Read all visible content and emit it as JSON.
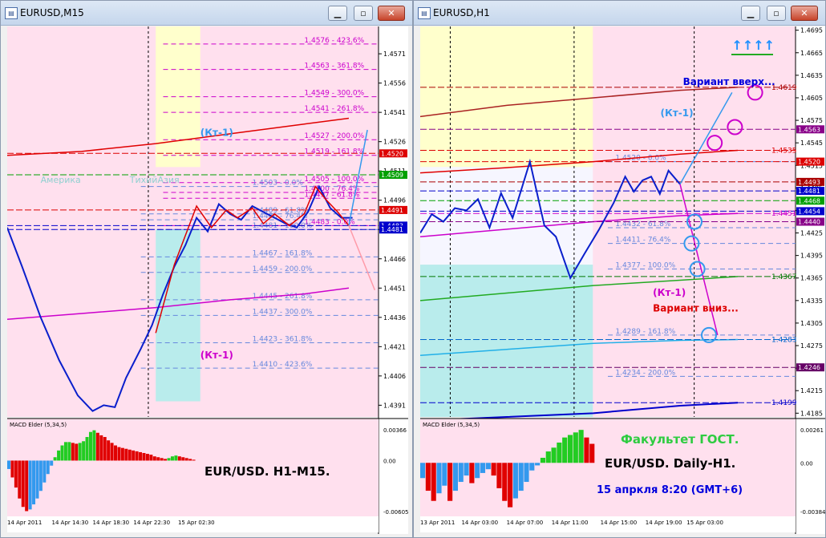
{
  "windows": [
    {
      "title": "EURUSD,M15",
      "chart_data": {
        "type": "line",
        "symbol": "EURUSD",
        "timeframe": "M15",
        "ylim": [
          1.4385,
          1.4585
        ],
        "price_ticks": [
          "1.4571",
          "1.4556",
          "1.4541",
          "1.4526",
          "1.4511",
          "1.4496",
          "1.4481",
          "1.4466",
          "1.4451",
          "1.4436",
          "1.4421",
          "1.4406",
          "1.4391"
        ],
        "price_tick_values": [
          1.4571,
          1.4556,
          1.4541,
          1.4526,
          1.4511,
          1.4496,
          1.4481,
          1.4466,
          1.4451,
          1.4436,
          1.4421,
          1.4406,
          1.4391
        ],
        "time_labels": [
          "14 Apr 2011",
          "14 Apr 14:30",
          "14 Apr 18:30",
          "14 Apr 22:30",
          "15 Apr 02:30"
        ],
        "fib_labels": [
          {
            "price": 1.4576,
            "text": "1.4576 - 423.6%",
            "color": "#cc00cc"
          },
          {
            "price": 1.4563,
            "text": "1.4563 - 361.8%",
            "color": "#cc00cc"
          },
          {
            "price": 1.4549,
            "text": "1.4549 - 300.0%",
            "color": "#cc00cc"
          },
          {
            "price": 1.4541,
            "text": "1.4541 - 261.8%",
            "color": "#cc00cc"
          },
          {
            "price": 1.4527,
            "text": "1.4527 - 200.0%",
            "color": "#cc00cc"
          },
          {
            "price": 1.4519,
            "text": "1.4519 - 161.8%",
            "color": "#cc00cc"
          },
          {
            "price": 1.4505,
            "text": "1.4505 - 100.0%",
            "color": "#cc00cc"
          },
          {
            "price": 1.45,
            "text": "1.4500 - 76.4%",
            "color": "#cc00cc"
          },
          {
            "price": 1.4497,
            "text": "1.4497 - 61.8%",
            "color": "#cc00cc"
          },
          {
            "price": 1.4483,
            "text": "1.4483 - 0.0%",
            "color": "#cc00cc"
          },
          {
            "price": 1.4503,
            "text": "1.4503 - 0.0%",
            "color": "#6688dd"
          },
          {
            "price": 1.4489,
            "text": "1.4489 - 61.8%",
            "color": "#6688dd"
          },
          {
            "price": 1.4486,
            "text": "1.4486 - 76.4%",
            "color": "#6688dd"
          },
          {
            "price": 1.4481,
            "text": "1.4481 - 100.0%",
            "color": "#6688dd"
          },
          {
            "price": 1.4467,
            "text": "1.4467 - 161.8%",
            "color": "#6688dd"
          },
          {
            "price": 1.4459,
            "text": "1.4459 - 200.0%",
            "color": "#6688dd"
          },
          {
            "price": 1.4445,
            "text": "1.4445 - 261.8%",
            "color": "#6688dd"
          },
          {
            "price": 1.4437,
            "text": "1.4437 - 300.0%",
            "color": "#6688dd"
          },
          {
            "price": 1.4423,
            "text": "1.4423 - 361.8%",
            "color": "#6688dd"
          },
          {
            "price": 1.441,
            "text": "1.4410 - 423.6%",
            "color": "#6688dd"
          }
        ],
        "price_tags": [
          {
            "price": 1.452,
            "text": "1.4520",
            "bg": "#dd0000"
          },
          {
            "price": 1.4509,
            "text": "1.4509",
            "bg": "#00a000"
          },
          {
            "price": 1.4491,
            "text": "1.4491",
            "bg": "#dd0000"
          },
          {
            "price": 1.4483,
            "text": "1.4483",
            "bg": "#0000cc"
          },
          {
            "price": 1.4481,
            "text": "1.4481",
            "bg": "#0000cc"
          }
        ],
        "session_labels": [
          "Америка",
          "ТихийАзия"
        ],
        "annotations": {
          "up_label": "(Кт-1)",
          "down_label": "(Кт-1)",
          "caption": "EUR/USD. H1-M15."
        },
        "price_path": [
          [
            0,
            1.4482
          ],
          [
            4,
            1.4462
          ],
          [
            9,
            1.4436
          ],
          [
            14,
            1.4414
          ],
          [
            19,
            1.4396
          ],
          [
            23,
            1.4388
          ],
          [
            26,
            1.4391
          ],
          [
            29,
            1.439
          ],
          [
            32,
            1.4405
          ],
          [
            36,
            1.442
          ],
          [
            39,
            1.4432
          ],
          [
            42,
            1.4448
          ],
          [
            45,
            1.4462
          ],
          [
            48,
            1.4473
          ],
          [
            51,
            1.4487
          ],
          [
            54,
            1.448
          ],
          [
            57,
            1.4494
          ],
          [
            60,
            1.4489
          ],
          [
            63,
            1.4486
          ],
          [
            66,
            1.4493
          ],
          [
            69,
            1.449
          ],
          [
            72,
            1.4487
          ],
          [
            75,
            1.4484
          ],
          [
            78,
            1.4482
          ],
          [
            81,
            1.449
          ],
          [
            84,
            1.4503
          ],
          [
            87,
            1.4492
          ],
          [
            90,
            1.4487
          ],
          [
            93,
            1.4487
          ]
        ],
        "red_path": [
          [
            40,
            1.4428
          ],
          [
            45,
            1.4463
          ],
          [
            48,
            1.4478
          ],
          [
            51,
            1.4493
          ],
          [
            55,
            1.4482
          ],
          [
            59,
            1.4491
          ],
          [
            62,
            1.4487
          ],
          [
            66,
            1.4492
          ],
          [
            69,
            1.4484
          ],
          [
            72,
            1.4489
          ],
          [
            76,
            1.4483
          ],
          [
            80,
            1.4489
          ],
          [
            83,
            1.4503
          ],
          [
            86,
            1.4496
          ],
          [
            89,
            1.449
          ],
          [
            92,
            1.4483
          ]
        ],
        "projection_up": [
          [
            92,
            1.4483
          ],
          [
            97,
            1.4532
          ]
        ],
        "projection_down": [
          [
            92,
            1.4483
          ],
          [
            99,
            1.445
          ]
        ],
        "red_ma": [
          [
            0,
            1.4519
          ],
          [
            20,
            1.4521
          ],
          [
            40,
            1.4525
          ],
          [
            60,
            1.453
          ],
          [
            80,
            1.4535
          ],
          [
            92,
            1.4538
          ]
        ],
        "magenta_ma": [
          [
            0,
            1.4435
          ],
          [
            20,
            1.4438
          ],
          [
            40,
            1.4441
          ],
          [
            60,
            1.4445
          ],
          [
            80,
            1.4448
          ],
          [
            92,
            1.4451
          ]
        ],
        "macd": {
          "label": "MACD Elder (5,34,5)",
          "ticks": [
            "0.00366",
            "0.00",
            "-0.00605"
          ],
          "ylim": [
            -0.00605,
            0.00366
          ],
          "values": [
            -0.001,
            -0.002,
            -0.0032,
            -0.0045,
            -0.0055,
            -0.006,
            -0.0058,
            -0.0052,
            -0.0045,
            -0.0036,
            -0.0026,
            -0.0016,
            -0.0006,
            0.0004,
            0.0012,
            0.0018,
            0.0022,
            0.0022,
            0.0021,
            0.002,
            0.0021,
            0.0023,
            0.0028,
            0.0034,
            0.0036,
            0.0033,
            0.003,
            0.0028,
            0.0024,
            0.0021,
            0.0018,
            0.0016,
            0.0015,
            0.0014,
            0.0013,
            0.0012,
            0.0011,
            0.001,
            0.0009,
            0.0008,
            0.0007,
            0.0005,
            0.0004,
            0.0003,
            0.0002,
            0.0003,
            0.0005,
            0.0006,
            0.0005,
            0.0004,
            0.0003,
            0.0002,
            0.0001
          ]
        }
      }
    },
    {
      "title": "EURUSD,H1",
      "chart_data": {
        "type": "line",
        "symbol": "EURUSD",
        "timeframe": "H1",
        "ylim": [
          1.418,
          1.47
        ],
        "price_ticks": [
          "1.4695",
          "1.4665",
          "1.4635",
          "1.4605",
          "1.4575",
          "1.4545",
          "1.4515",
          "1.4485",
          "1.4455",
          "1.4425",
          "1.4395",
          "1.4365",
          "1.4335",
          "1.4305",
          "1.4275",
          "1.4245",
          "1.4215",
          "1.4185"
        ],
        "price_tick_values": [
          1.4695,
          1.4665,
          1.4635,
          1.4605,
          1.4575,
          1.4545,
          1.4515,
          1.4485,
          1.4455,
          1.4425,
          1.4395,
          1.4365,
          1.4335,
          1.4305,
          1.4275,
          1.4245,
          1.4215,
          1.4185
        ],
        "time_labels": [
          "13 Apr 2011",
          "14 Apr 03:00",
          "14 Apr 07:00",
          "14 Apr 11:00",
          "14 Apr 15:00",
          "14 Apr 19:00",
          "15 Apr 03:00"
        ],
        "fib_labels": [
          {
            "price": 1.452,
            "text": "1.4520 - 0.0%",
            "color": "#6688dd"
          },
          {
            "price": 1.4432,
            "text": "1.4432 - 61.8%",
            "color": "#6688dd"
          },
          {
            "price": 1.4411,
            "text": "1.4411 - 76.4%",
            "color": "#6688dd"
          },
          {
            "price": 1.4377,
            "text": "1.4377 - 100.0%",
            "color": "#6688dd"
          },
          {
            "price": 1.4289,
            "text": "1.4289 - 161.8%",
            "color": "#6688dd"
          },
          {
            "price": 1.4234,
            "text": "1.4234 - 200.0%",
            "color": "#6688dd"
          }
        ],
        "price_tags": [
          {
            "price": 1.4619,
            "text": "1.4619",
            "bg": "",
            "fg": "#aa0000"
          },
          {
            "price": 1.4563,
            "text": "1.4563",
            "bg": "#880088"
          },
          {
            "price": 1.4535,
            "text": "1.4535",
            "bg": "",
            "fg": "#dd0000"
          },
          {
            "price": 1.452,
            "text": "1.4520",
            "bg": "#dd0000"
          },
          {
            "price": 1.4493,
            "text": "1.4493",
            "bg": "#aa0000"
          },
          {
            "price": 1.4481,
            "text": "1.4481",
            "bg": "#0000cc"
          },
          {
            "price": 1.4468,
            "text": "1.4468",
            "bg": "#00a000"
          },
          {
            "price": 1.4454,
            "text": "1.4454",
            "bg": "#0000cc"
          },
          {
            "price": 1.4451,
            "text": "1.4451",
            "bg": "",
            "fg": "#cc00cc"
          },
          {
            "price": 1.444,
            "text": "1.4440",
            "bg": "#880088"
          },
          {
            "price": 1.4367,
            "text": "1.4367",
            "bg": "",
            "fg": "#007700"
          },
          {
            "price": 1.4283,
            "text": "1.4283",
            "bg": "",
            "fg": "#0066cc"
          },
          {
            "price": 1.4246,
            "text": "1.4246",
            "bg": "#660066"
          },
          {
            "price": 1.4199,
            "text": "1.4199",
            "bg": "",
            "fg": "#0000cc"
          }
        ],
        "annotations": {
          "arrows": "↑↑↑↑",
          "variant_up": "Вариант вверх...",
          "variant_down": "Вариант вниз...",
          "up_label": "(Кт-1)",
          "down_label": "(Кт-1)",
          "faculty": "Факультет ГОСТ.",
          "caption": "EUR/USD. Daily-H1.",
          "datetime": "15 апркля  8:20 (GMT+6)"
        },
        "price_path": [
          [
            0,
            1.4425
          ],
          [
            4,
            1.445
          ],
          [
            8,
            1.444
          ],
          [
            12,
            1.4458
          ],
          [
            16,
            1.4455
          ],
          [
            20,
            1.447
          ],
          [
            24,
            1.4432
          ],
          [
            28,
            1.4478
          ],
          [
            32,
            1.4445
          ],
          [
            38,
            1.452
          ],
          [
            43,
            1.4435
          ],
          [
            47,
            1.442
          ],
          [
            52,
            1.4365
          ],
          [
            57,
            1.4398
          ],
          [
            62,
            1.443
          ],
          [
            67,
            1.4465
          ],
          [
            71,
            1.45
          ],
          [
            74,
            1.448
          ],
          [
            77,
            1.4495
          ],
          [
            80,
            1.45
          ],
          [
            83,
            1.4477
          ],
          [
            86,
            1.4508
          ],
          [
            90,
            1.449
          ]
        ],
        "projection_up": [
          [
            90,
            1.449
          ],
          [
            108,
            1.4612
          ]
        ],
        "projection_down": [
          [
            90,
            1.449
          ],
          [
            103,
            1.4289
          ]
        ],
        "circles_up": [
          [
            102,
            1.4545
          ],
          [
            109,
            1.4566
          ],
          [
            116,
            1.4612
          ]
        ],
        "circles_down": [
          [
            95,
            1.444
          ],
          [
            94,
            1.4411
          ],
          [
            96,
            1.4377
          ],
          [
            100,
            1.4289
          ]
        ],
        "dark_red_ma": [
          [
            0,
            1.458
          ],
          [
            30,
            1.4595
          ],
          [
            60,
            1.4605
          ],
          [
            90,
            1.4615
          ],
          [
            110,
            1.4619
          ]
        ],
        "red_ma": [
          [
            0,
            1.4505
          ],
          [
            30,
            1.4512
          ],
          [
            60,
            1.452
          ],
          [
            90,
            1.453
          ],
          [
            110,
            1.4535
          ]
        ],
        "magenta_ma": [
          [
            0,
            1.442
          ],
          [
            30,
            1.443
          ],
          [
            60,
            1.444
          ],
          [
            90,
            1.4448
          ],
          [
            110,
            1.4451
          ]
        ],
        "green_ma": [
          [
            0,
            1.4335
          ],
          [
            30,
            1.4345
          ],
          [
            60,
            1.4355
          ],
          [
            90,
            1.4362
          ],
          [
            110,
            1.4367
          ]
        ],
        "cyan_ma": [
          [
            0,
            1.4262
          ],
          [
            30,
            1.427
          ],
          [
            60,
            1.4278
          ],
          [
            90,
            1.4282
          ],
          [
            110,
            1.4283
          ]
        ],
        "blue_ma": [
          [
            0,
            1.4175
          ],
          [
            30,
            1.418
          ],
          [
            60,
            1.4185
          ],
          [
            90,
            1.4195
          ],
          [
            110,
            1.4199
          ]
        ],
        "macd": {
          "label": "MACD Elder (5,34,5)",
          "ticks": [
            "0.00261",
            "0.00",
            "-0.00384"
          ],
          "ylim": [
            -0.00384,
            0.00261
          ],
          "values": [
            -0.0012,
            -0.0022,
            -0.003,
            -0.0024,
            -0.0018,
            -0.003,
            -0.0022,
            -0.0015,
            -0.001,
            -0.0016,
            -0.0012,
            -0.0008,
            -0.0005,
            -0.001,
            -0.002,
            -0.003,
            -0.0035,
            -0.0028,
            -0.0022,
            -0.0015,
            -0.0006,
            -0.0002,
            0.0004,
            0.0009,
            0.0012,
            0.0016,
            0.002,
            0.0022,
            0.0024,
            0.0026,
            0.002,
            0.0015
          ]
        }
      }
    }
  ]
}
